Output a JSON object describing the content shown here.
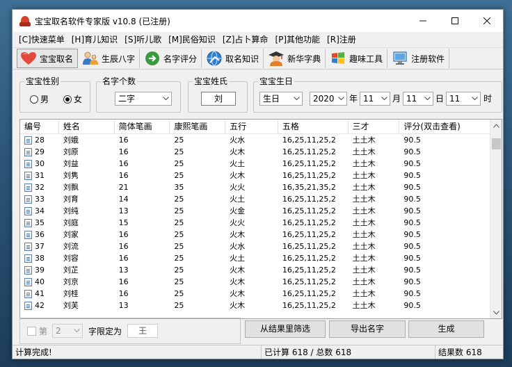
{
  "window": {
    "title": "宝宝取名软件专家版 v10.8 (已注册)"
  },
  "menu": [
    "[C]快速菜单",
    "[H]育儿知识",
    "[S]听儿歌",
    "[M]民俗知识",
    "[Z]占卜算命",
    "[P]其他功能",
    "[R]注册"
  ],
  "toolbar": [
    {
      "label": "宝宝取名",
      "icon": "heart-icon"
    },
    {
      "label": "生辰八字",
      "icon": "people-icon"
    },
    {
      "label": "名字评分",
      "icon": "arrow-right-icon"
    },
    {
      "label": "取名知识",
      "icon": "globe-icon"
    },
    {
      "label": "新华字典",
      "icon": "scholar-icon"
    },
    {
      "label": "趣味工具",
      "icon": "windows-icon"
    },
    {
      "label": "注册软件",
      "icon": "monitor-icon"
    }
  ],
  "gender": {
    "title": "宝宝性别",
    "male": "男",
    "female": "女",
    "selected": "female"
  },
  "name_count": {
    "title": "名字个数",
    "value": "二字"
  },
  "surname": {
    "title": "宝宝姓氏",
    "value": "刘"
  },
  "birthday": {
    "title": "宝宝生日",
    "calendar": "生日",
    "year": "2020",
    "year_unit": "年",
    "month": "11",
    "month_unit": "月",
    "day": "11",
    "day_unit": "日",
    "hour": "11",
    "hour_unit": "时"
  },
  "table": {
    "columns": [
      "编号",
      "姓名",
      "简体笔画",
      "康熙笔画",
      "五行",
      "五格",
      "三才",
      "评分(双击查看)"
    ],
    "rows": [
      [
        "28",
        "刘娥",
        "16",
        "25",
        "火水",
        "16,25,11,25,2",
        "土土木",
        "90.5"
      ],
      [
        "29",
        "刘原",
        "16",
        "25",
        "火木",
        "16,25,11,25,2",
        "土土木",
        "90.5"
      ],
      [
        "30",
        "刘益",
        "16",
        "25",
        "火土",
        "16,25,11,25,2",
        "土土木",
        "90.5"
      ],
      [
        "31",
        "刘隽",
        "16",
        "25",
        "火木",
        "16,25,11,25,2",
        "土土木",
        "90.5"
      ],
      [
        "32",
        "刘飘",
        "21",
        "35",
        "火火",
        "16,35,21,35,2",
        "土土木",
        "90.5"
      ],
      [
        "33",
        "刘育",
        "14",
        "25",
        "火土",
        "16,25,11,25,2",
        "土土木",
        "90.5"
      ],
      [
        "34",
        "刘纯",
        "13",
        "25",
        "火金",
        "16,25,11,25,2",
        "土土木",
        "90.5"
      ],
      [
        "35",
        "刘庭",
        "15",
        "25",
        "火火",
        "16,25,11,25,2",
        "土土木",
        "90.5"
      ],
      [
        "36",
        "刘家",
        "16",
        "25",
        "火木",
        "16,25,11,25,2",
        "土土木",
        "90.5"
      ],
      [
        "37",
        "刘流",
        "16",
        "25",
        "火水",
        "16,25,11,25,2",
        "土土木",
        "90.5"
      ],
      [
        "38",
        "刘容",
        "16",
        "25",
        "火土",
        "16,25,11,25,2",
        "土土木",
        "90.5"
      ],
      [
        "39",
        "刘芷",
        "13",
        "25",
        "火木",
        "16,25,11,25,2",
        "土土木",
        "90.5"
      ],
      [
        "40",
        "刘京",
        "16",
        "25",
        "火木",
        "16,25,11,25,2",
        "土土木",
        "90.5"
      ],
      [
        "41",
        "刘桂",
        "16",
        "25",
        "火木",
        "16,25,11,25,2",
        "土土木",
        "90.5"
      ],
      [
        "42",
        "刘芙",
        "13",
        "25",
        "火木",
        "16,25,11,25,2",
        "土土木",
        "90.5"
      ]
    ]
  },
  "filter": {
    "prefix": "第",
    "position": "2",
    "label": "字限定为",
    "char": "王"
  },
  "buttons": {
    "filter": "从结果里筛选",
    "export": "导出名字",
    "generate": "生成"
  },
  "status": {
    "message": "计算完成!",
    "progress": "已计算 618 / 总数 618",
    "result": "结果数 618"
  }
}
